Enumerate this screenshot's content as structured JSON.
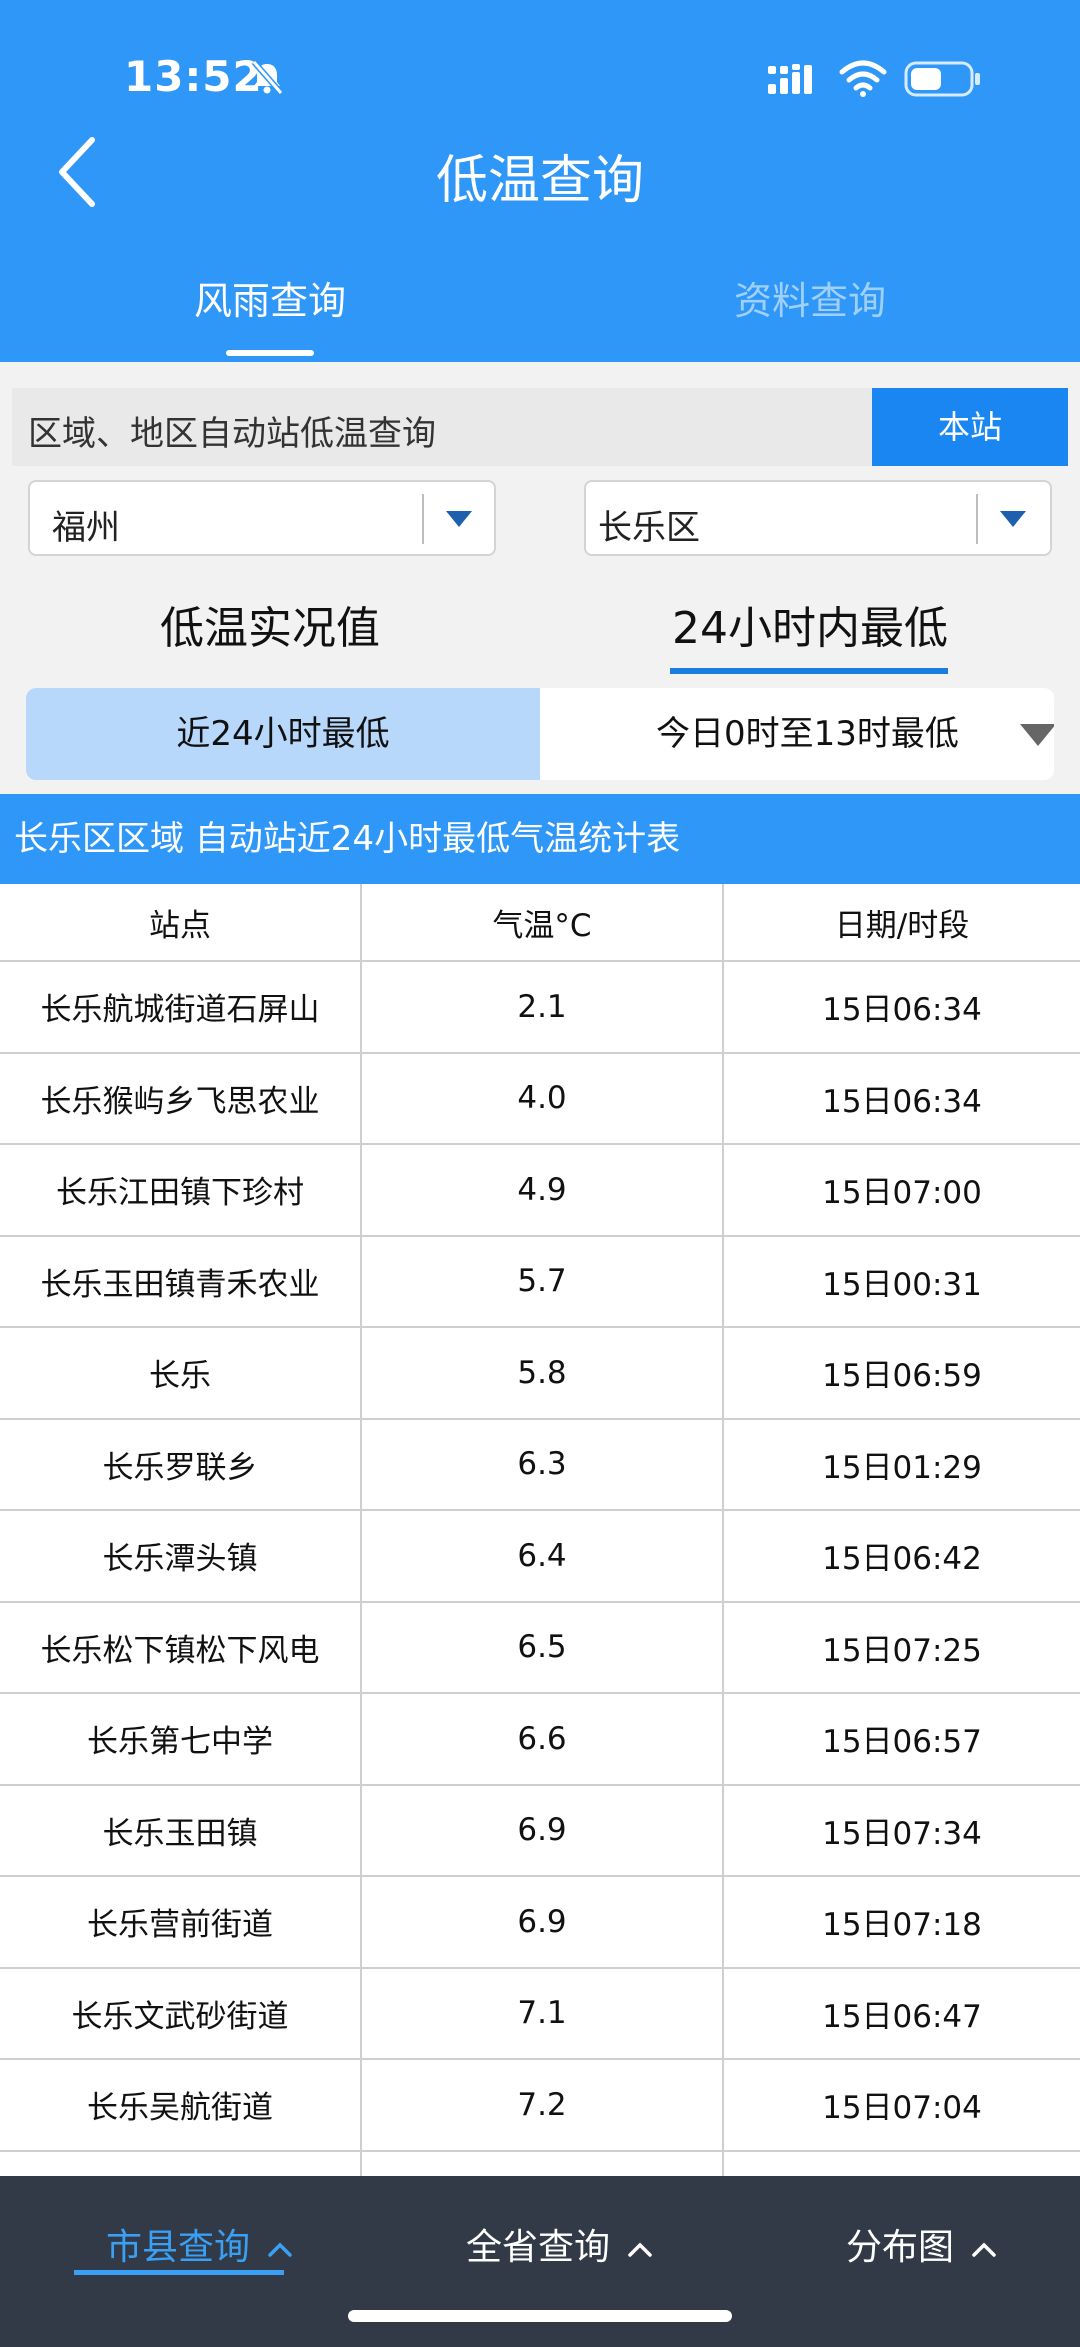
{
  "status_bar": {
    "time": "13:52"
  },
  "header": {
    "title": "低温查询"
  },
  "top_tabs": [
    {
      "label": "风雨查询",
      "active": true
    },
    {
      "label": "资料查询",
      "active": false
    }
  ],
  "query": {
    "label": "区域、地区自动站低温查询",
    "station_button": "本站"
  },
  "selects": {
    "city": "福州",
    "district": "长乐区"
  },
  "mode_tabs": [
    {
      "label": "低温实况值",
      "active": false
    },
    {
      "label": "24小时内最低",
      "active": true
    }
  ],
  "range": {
    "left": "近24小时最低",
    "right": "今日0时至13时最低"
  },
  "table": {
    "title": "长乐区区域 自动站近24小时最低气温统计表",
    "headers": [
      "站点",
      "气温°C",
      "日期/时段"
    ],
    "rows": [
      [
        "长乐航城街道石屏山",
        "2.1",
        "15日06:34"
      ],
      [
        "长乐猴屿乡飞思农业",
        "4.0",
        "15日06:34"
      ],
      [
        "长乐江田镇下珍村",
        "4.9",
        "15日07:00"
      ],
      [
        "长乐玉田镇青禾农业",
        "5.7",
        "15日00:31"
      ],
      [
        "长乐",
        "5.8",
        "15日06:59"
      ],
      [
        "长乐罗联乡",
        "6.3",
        "15日01:29"
      ],
      [
        "长乐潭头镇",
        "6.4",
        "15日06:42"
      ],
      [
        "长乐松下镇松下风电",
        "6.5",
        "15日07:25"
      ],
      [
        "长乐第七中学",
        "6.6",
        "15日06:57"
      ],
      [
        "长乐玉田镇",
        "6.9",
        "15日07:34"
      ],
      [
        "长乐营前街道",
        "6.9",
        "15日07:18"
      ],
      [
        "长乐文武砂街道",
        "7.1",
        "15日06:47"
      ],
      [
        "长乐吴航街道",
        "7.2",
        "15日07:04"
      ]
    ]
  },
  "bottom_tabs": [
    {
      "label": "市县查询",
      "active": true
    },
    {
      "label": "全省查询",
      "active": false
    },
    {
      "label": "分布图",
      "active": false
    }
  ],
  "colors": {
    "header_blue": "#2f97f7",
    "button_blue": "#1a86f1",
    "bottom_bar": "#323a47",
    "segment_selected": "#b7d7fb"
  }
}
